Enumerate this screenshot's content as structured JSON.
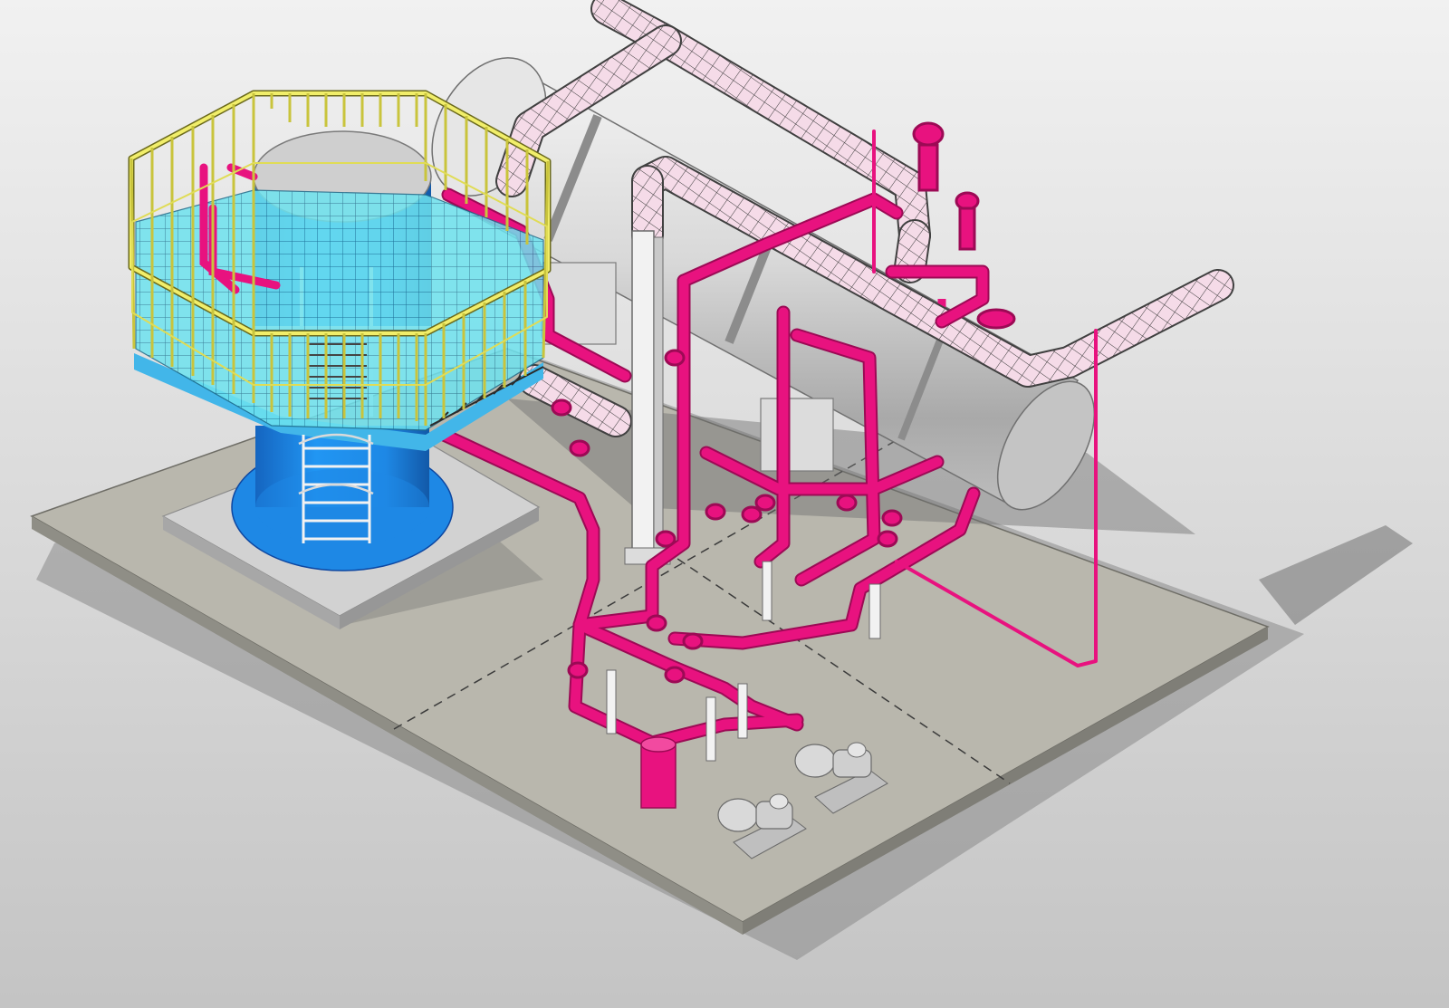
{
  "scene": {
    "colors": {
      "background_top": "#f1f1f1",
      "background_bottom": "#c4c4c4",
      "slab_top": "#b9b7ad",
      "slab_side": "#8f8e86",
      "slab_shadow": "#6f6f6f",
      "pedestal": "#d2d2d2",
      "tank_blue": "#1e88e5",
      "tank_blue_dark": "#1565c0",
      "tank_top": "#cfcfcf",
      "platform_deck": "#6ee3ef",
      "platform_grid": "#1e6b8a",
      "guardrail": "#f1ee6a",
      "guardrail_edge": "#6b6a1c",
      "drum_light": "#efefef",
      "drum_mid": "#cfcfcf",
      "drum_dark": "#9a9a9a",
      "insulated_pipe": "#f5dbe8",
      "insulated_hatch": "#3a3a3a",
      "process_pipe": "#e8127f",
      "process_pipe_dark": "#9c0a55",
      "support_steel": "#f2f2f2",
      "pump": "#d9d9d9",
      "pump_dark": "#9a9a9a"
    }
  }
}
